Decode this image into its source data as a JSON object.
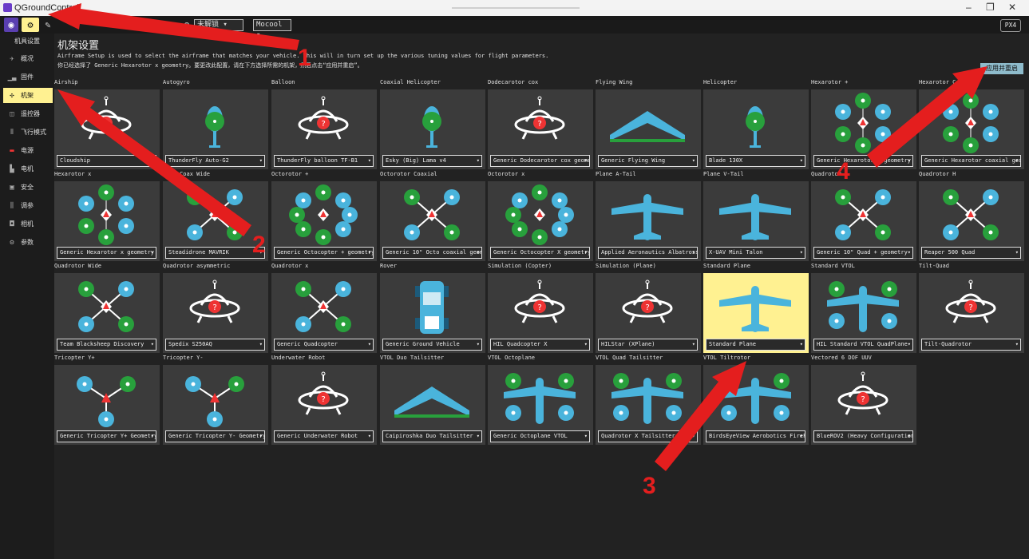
{
  "app": {
    "title": "QGroundControl"
  },
  "toolbar": {
    "battery": "N/A",
    "mode": "未解锁",
    "vehicle": "Mocool",
    "brand": "PX4"
  },
  "sidebar": {
    "header": "机具设置",
    "items": [
      {
        "label": "概况",
        "icon": "plane-icon"
      },
      {
        "label": "固件",
        "icon": "firmware-icon"
      },
      {
        "label": "机架",
        "icon": "airframe-icon",
        "active": true
      },
      {
        "label": "遥控器",
        "icon": "radio-icon"
      },
      {
        "label": "飞行模式",
        "icon": "flightmode-icon"
      },
      {
        "label": "电源",
        "icon": "power-icon"
      },
      {
        "label": "电机",
        "icon": "motor-icon"
      },
      {
        "label": "安全",
        "icon": "safety-icon"
      },
      {
        "label": "调参",
        "icon": "tuning-icon"
      },
      {
        "label": "相机",
        "icon": "camera-icon"
      },
      {
        "label": "参数",
        "icon": "params-icon"
      }
    ]
  },
  "main": {
    "title": "机架设置",
    "description1": "Airframe Setup is used to select the airframe that matches your vehicle. This will in turn set up the various tuning values for flight parameters.",
    "description2": "你已经选择了 Generic Hexarotor x geometry。要更改此配置，请在下方选择所需的机架，然后点击“应用并重启”。",
    "apply_label": "应用并重启",
    "airframes": [
      {
        "group": "Airship",
        "value": "Cloudship",
        "icon": "ufo-icon"
      },
      {
        "group": "Autogyro",
        "value": "ThunderFly Auto-G2",
        "icon": "heli-icon"
      },
      {
        "group": "Balloon",
        "value": "ThunderFly balloon TF-B1",
        "icon": "ufo-icon"
      },
      {
        "group": "Coaxial Helicopter",
        "value": "Esky (Big) Lama v4",
        "icon": "heli-icon"
      },
      {
        "group": "Dodecarotor cox",
        "value": "Generic Dodecarotor cox geometry",
        "icon": "ufo-icon"
      },
      {
        "group": "Flying Wing",
        "value": "Generic Flying Wing",
        "icon": "wing-icon"
      },
      {
        "group": "Helicopter",
        "value": "Blade 130X",
        "icon": "heli-icon"
      },
      {
        "group": "Hexarotor +",
        "value": "Generic Hexarotor + geometry",
        "icon": "hexa-icon"
      },
      {
        "group": "Hexarotor Coaxial",
        "value": "Generic Hexarotor coaxial geometry",
        "icon": "hexa-icon"
      },
      {
        "group": "Hexarotor x",
        "value": "Generic Hexarotor x geometry",
        "icon": "hexa-icon"
      },
      {
        "group": "Octo Coax Wide",
        "value": "Steadidrone MAVRIK",
        "icon": "quad-icon"
      },
      {
        "group": "Octorotor +",
        "value": "Generic Octocopter + geometry",
        "icon": "octo-icon"
      },
      {
        "group": "Octorotor Coaxial",
        "value": "Generic 10\" Octo coaxial geometry",
        "icon": "quad-icon"
      },
      {
        "group": "Octorotor x",
        "value": "Generic Octocopter X geometry",
        "icon": "octo-icon"
      },
      {
        "group": "Plane A-Tail",
        "value": "Applied Aeronautics Albatross",
        "icon": "plane-icon"
      },
      {
        "group": "Plane V-Tail",
        "value": "X-UAV Mini Talon",
        "icon": "plane-icon"
      },
      {
        "group": "Quadrotor +",
        "value": "Generic 10\" Quad + geometry",
        "icon": "quad-icon"
      },
      {
        "group": "Quadrotor H",
        "value": "Reaper 500 Quad",
        "icon": "quad-icon"
      },
      {
        "group": "Quadrotor Wide",
        "value": "Team Blacksheep Discovery",
        "icon": "quad-icon"
      },
      {
        "group": "Quadrotor asymmetric",
        "value": "Spedix S250AQ",
        "icon": "ufo-icon"
      },
      {
        "group": "Quadrotor x",
        "value": "Generic Quadcopter",
        "icon": "quad-icon"
      },
      {
        "group": "Rover",
        "value": "Generic Ground Vehicle",
        "icon": "rover-icon"
      },
      {
        "group": "Simulation (Copter)",
        "value": "HIL Quadcopter X",
        "icon": "ufo-icon"
      },
      {
        "group": "Simulation (Plane)",
        "value": "HILStar (XPlane)",
        "icon": "ufo-icon"
      },
      {
        "group": "Standard Plane",
        "value": "Standard Plane",
        "icon": "plane-icon",
        "selected": true
      },
      {
        "group": "Standard VTOL",
        "value": "HIL Standard VTOL QuadPlane",
        "icon": "vtol-icon"
      },
      {
        "group": "Tilt-Quad",
        "value": "Tilt-Quadrotor",
        "icon": "ufo-icon"
      },
      {
        "group": "Tricopter Y+",
        "value": "Generic Tricopter Y+ Geometry",
        "icon": "tri-icon"
      },
      {
        "group": "Tricopter Y-",
        "value": "Generic Tricopter Y- Geometry",
        "icon": "tri-icon"
      },
      {
        "group": "Underwater Robot",
        "value": "Generic Underwater Robot",
        "icon": "ufo-icon"
      },
      {
        "group": "VTOL Duo Tailsitter",
        "value": "Caipiroshka Duo Tailsitter",
        "icon": "wing-icon"
      },
      {
        "group": "VTOL Octoplane",
        "value": "Generic Octoplane VTOL",
        "icon": "vtol-icon"
      },
      {
        "group": "VTOL Quad Tailsitter",
        "value": "Quadrotor X Tailsitter",
        "icon": "vtol-icon"
      },
      {
        "group": "VTOL Tiltrotor",
        "value": "BirdsEyeView Aerobotics FireFLY6",
        "icon": "vtol-icon"
      },
      {
        "group": "Vectored 6 DOF UUV",
        "value": "BlueROV2 (Heavy Configuration)",
        "icon": "ufo-icon"
      }
    ]
  },
  "annotations": [
    "1",
    "2",
    "3",
    "4"
  ],
  "colors": {
    "selected": "#fff191",
    "arrow": "#e41e1e",
    "frame_blue": "#4ab4dc",
    "frame_green": "#28a03c"
  }
}
